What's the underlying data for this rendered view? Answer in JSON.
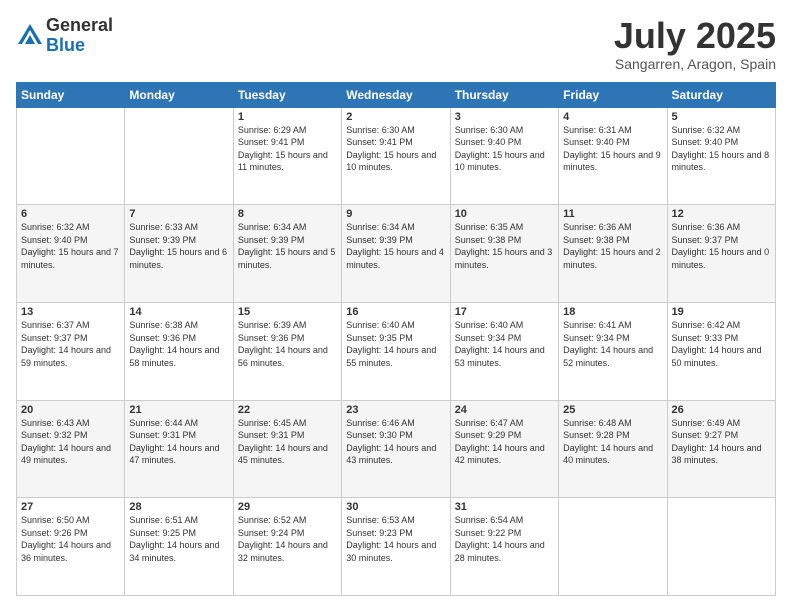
{
  "logo": {
    "general": "General",
    "blue": "Blue"
  },
  "title": "July 2025",
  "location": "Sangarren, Aragon, Spain",
  "weekdays": [
    "Sunday",
    "Monday",
    "Tuesday",
    "Wednesday",
    "Thursday",
    "Friday",
    "Saturday"
  ],
  "weeks": [
    [
      {
        "day": "",
        "info": ""
      },
      {
        "day": "",
        "info": ""
      },
      {
        "day": "1",
        "info": "Sunrise: 6:29 AM\nSunset: 9:41 PM\nDaylight: 15 hours and 11 minutes."
      },
      {
        "day": "2",
        "info": "Sunrise: 6:30 AM\nSunset: 9:41 PM\nDaylight: 15 hours and 10 minutes."
      },
      {
        "day": "3",
        "info": "Sunrise: 6:30 AM\nSunset: 9:40 PM\nDaylight: 15 hours and 10 minutes."
      },
      {
        "day": "4",
        "info": "Sunrise: 6:31 AM\nSunset: 9:40 PM\nDaylight: 15 hours and 9 minutes."
      },
      {
        "day": "5",
        "info": "Sunrise: 6:32 AM\nSunset: 9:40 PM\nDaylight: 15 hours and 8 minutes."
      }
    ],
    [
      {
        "day": "6",
        "info": "Sunrise: 6:32 AM\nSunset: 9:40 PM\nDaylight: 15 hours and 7 minutes."
      },
      {
        "day": "7",
        "info": "Sunrise: 6:33 AM\nSunset: 9:39 PM\nDaylight: 15 hours and 6 minutes."
      },
      {
        "day": "8",
        "info": "Sunrise: 6:34 AM\nSunset: 9:39 PM\nDaylight: 15 hours and 5 minutes."
      },
      {
        "day": "9",
        "info": "Sunrise: 6:34 AM\nSunset: 9:39 PM\nDaylight: 15 hours and 4 minutes."
      },
      {
        "day": "10",
        "info": "Sunrise: 6:35 AM\nSunset: 9:38 PM\nDaylight: 15 hours and 3 minutes."
      },
      {
        "day": "11",
        "info": "Sunrise: 6:36 AM\nSunset: 9:38 PM\nDaylight: 15 hours and 2 minutes."
      },
      {
        "day": "12",
        "info": "Sunrise: 6:36 AM\nSunset: 9:37 PM\nDaylight: 15 hours and 0 minutes."
      }
    ],
    [
      {
        "day": "13",
        "info": "Sunrise: 6:37 AM\nSunset: 9:37 PM\nDaylight: 14 hours and 59 minutes."
      },
      {
        "day": "14",
        "info": "Sunrise: 6:38 AM\nSunset: 9:36 PM\nDaylight: 14 hours and 58 minutes."
      },
      {
        "day": "15",
        "info": "Sunrise: 6:39 AM\nSunset: 9:36 PM\nDaylight: 14 hours and 56 minutes."
      },
      {
        "day": "16",
        "info": "Sunrise: 6:40 AM\nSunset: 9:35 PM\nDaylight: 14 hours and 55 minutes."
      },
      {
        "day": "17",
        "info": "Sunrise: 6:40 AM\nSunset: 9:34 PM\nDaylight: 14 hours and 53 minutes."
      },
      {
        "day": "18",
        "info": "Sunrise: 6:41 AM\nSunset: 9:34 PM\nDaylight: 14 hours and 52 minutes."
      },
      {
        "day": "19",
        "info": "Sunrise: 6:42 AM\nSunset: 9:33 PM\nDaylight: 14 hours and 50 minutes."
      }
    ],
    [
      {
        "day": "20",
        "info": "Sunrise: 6:43 AM\nSunset: 9:32 PM\nDaylight: 14 hours and 49 minutes."
      },
      {
        "day": "21",
        "info": "Sunrise: 6:44 AM\nSunset: 9:31 PM\nDaylight: 14 hours and 47 minutes."
      },
      {
        "day": "22",
        "info": "Sunrise: 6:45 AM\nSunset: 9:31 PM\nDaylight: 14 hours and 45 minutes."
      },
      {
        "day": "23",
        "info": "Sunrise: 6:46 AM\nSunset: 9:30 PM\nDaylight: 14 hours and 43 minutes."
      },
      {
        "day": "24",
        "info": "Sunrise: 6:47 AM\nSunset: 9:29 PM\nDaylight: 14 hours and 42 minutes."
      },
      {
        "day": "25",
        "info": "Sunrise: 6:48 AM\nSunset: 9:28 PM\nDaylight: 14 hours and 40 minutes."
      },
      {
        "day": "26",
        "info": "Sunrise: 6:49 AM\nSunset: 9:27 PM\nDaylight: 14 hours and 38 minutes."
      }
    ],
    [
      {
        "day": "27",
        "info": "Sunrise: 6:50 AM\nSunset: 9:26 PM\nDaylight: 14 hours and 36 minutes."
      },
      {
        "day": "28",
        "info": "Sunrise: 6:51 AM\nSunset: 9:25 PM\nDaylight: 14 hours and 34 minutes."
      },
      {
        "day": "29",
        "info": "Sunrise: 6:52 AM\nSunset: 9:24 PM\nDaylight: 14 hours and 32 minutes."
      },
      {
        "day": "30",
        "info": "Sunrise: 6:53 AM\nSunset: 9:23 PM\nDaylight: 14 hours and 30 minutes."
      },
      {
        "day": "31",
        "info": "Sunrise: 6:54 AM\nSunset: 9:22 PM\nDaylight: 14 hours and 28 minutes."
      },
      {
        "day": "",
        "info": ""
      },
      {
        "day": "",
        "info": ""
      }
    ]
  ]
}
